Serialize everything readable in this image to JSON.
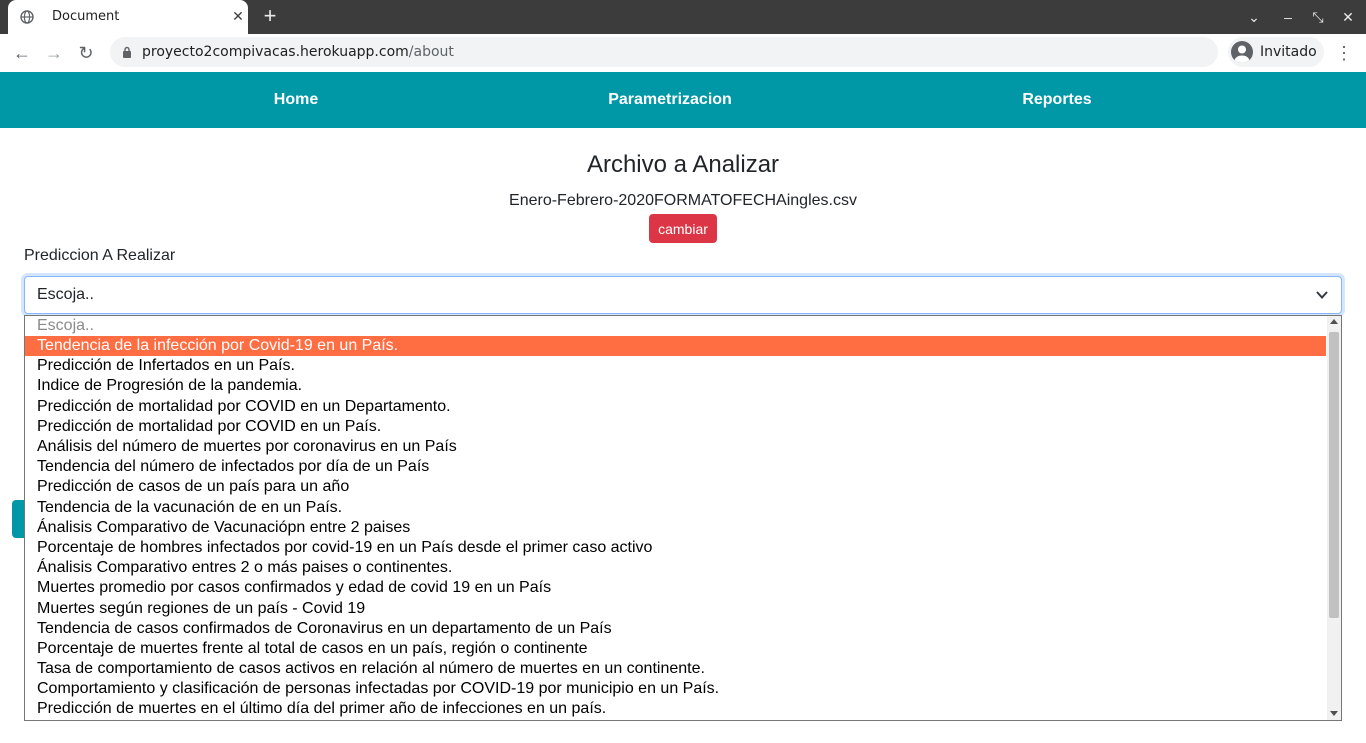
{
  "browser": {
    "tab_title": "Document",
    "tab_close": "✕",
    "new_tab": "+",
    "url_host": "proyecto2compivacas.herokuapp.com",
    "url_path": "/about",
    "profile_label": "Invitado",
    "window_controls": [
      "⌄",
      "–",
      "⤡",
      "✕"
    ],
    "nav": {
      "back": "←",
      "forward": "→",
      "reload": "↻",
      "menu": "⋮"
    }
  },
  "navbar": {
    "items": [
      {
        "label": "Home"
      },
      {
        "label": "Parametrizacion"
      },
      {
        "label": "Reportes"
      }
    ],
    "color": "#0097a7"
  },
  "main": {
    "title": "Archivo a Analizar",
    "file_name": "Enero-Febrero-2020FORMATOFECHAingles.csv",
    "change_button": "cambiar",
    "change_button_color": "#dc3545",
    "prediction_label": "Prediccion A Realizar",
    "select": {
      "value": "Escoja..",
      "options": [
        "Escoja..",
        "Tendencia de la infección por Covid-19 en un País.",
        "Predicción de Infertados en un País.",
        "Indice de Progresión de la pandemia.",
        "Predicción de mortalidad por COVID en un Departamento.",
        "Predicción de mortalidad por COVID en un País.",
        "Análisis del número de muertes por coronavirus en un País",
        "Tendencia del número de infectados por día de un País",
        "Predicción de casos de un país para un año",
        "Tendencia de la vacunación de en un País.",
        "Ánalisis Comparativo de Vacunaciópn entre 2 paises",
        "Porcentaje de hombres infectados por covid-19 en un País desde el primer caso activo",
        "Ánalisis Comparativo entres 2 o más paises o continentes.",
        "Muertes promedio por casos confirmados y edad de covid 19 en un País",
        "Muertes según regiones de un país - Covid 19",
        "Tendencia de casos confirmados de Coronavirus en un departamento de un País",
        "Porcentaje de muertes frente al total de casos en un país, región o continente",
        "Tasa de comportamiento de casos activos en relación al número de muertes en un continente.",
        "Comportamiento y clasificación de personas infectadas por COVID-19 por municipio en un País.",
        "Predicción de muertes en el último día del primer año de infecciones en un país."
      ],
      "highlighted_index": 1,
      "highlight_color": "#ff6d42"
    }
  }
}
